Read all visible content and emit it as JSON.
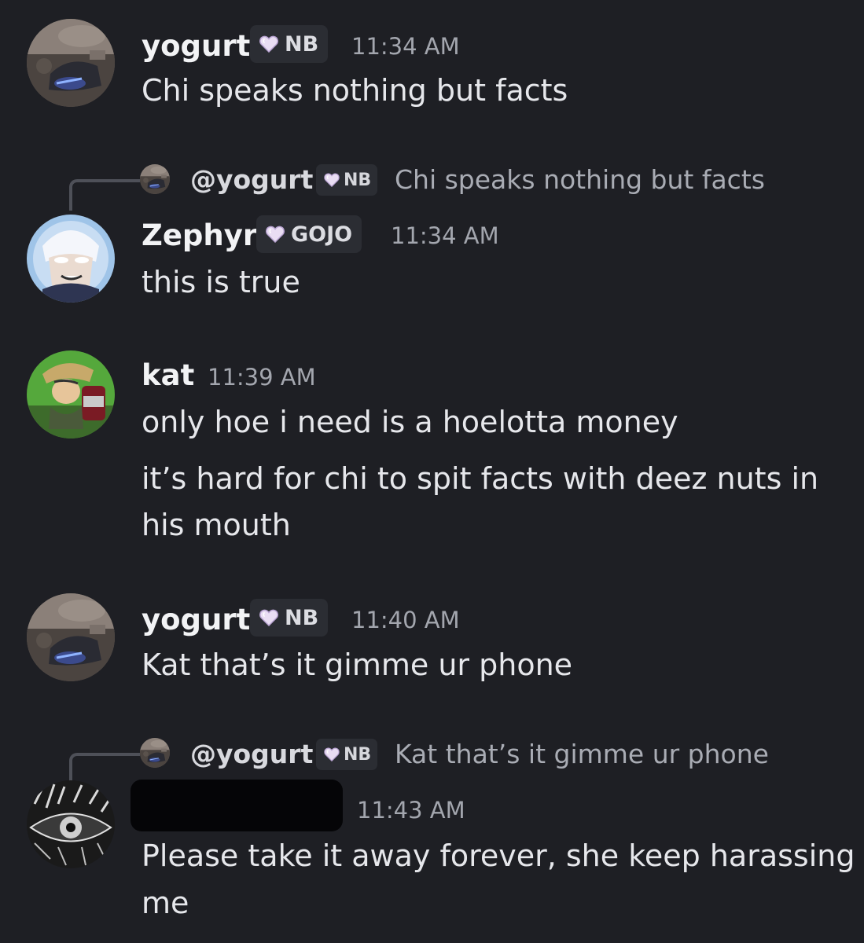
{
  "messages": [
    {
      "username": "yogurt",
      "badge": "NB",
      "timestamp": "11:34 AM",
      "avatar_icon": "yogurt-car-avatar",
      "lines": [
        "Chi speaks nothing but facts"
      ]
    },
    {
      "reply": {
        "mention": "@yogurt",
        "badge": "NB",
        "text": "Chi speaks nothing but facts"
      },
      "username": "Zephyr",
      "badge": "GOJO",
      "timestamp": "11:34 AM",
      "avatar_icon": "gojo-anime-avatar",
      "lines": [
        "this is true"
      ]
    },
    {
      "username": "kat",
      "timestamp": "11:39 AM",
      "avatar_icon": "jojo-dr-pepper-avatar",
      "lines": [
        "only hoe i need is a hoelotta money"
      ],
      "followup_lines": [
        "it’s hard for chi to spit facts with deez nuts in",
        "his mouth"
      ]
    },
    {
      "username": "yogurt",
      "badge": "NB",
      "timestamp": "11:40 AM",
      "avatar_icon": "yogurt-car-avatar",
      "lines": [
        "Kat that’s it gimme ur phone"
      ]
    },
    {
      "reply": {
        "mention": "@yogurt",
        "badge": "NB",
        "text": "Kat that’s it gimme ur phone"
      },
      "username_redacted": true,
      "timestamp": "11:43 AM",
      "avatar_icon": "sketch-eye-avatar",
      "lines": [
        "Please take it away forever, she keep harassing",
        "me"
      ]
    }
  ],
  "colors": {
    "background": "#1e1f24",
    "text": "#e6e7eb",
    "muted": "#a3a6ae",
    "badge_bg": "#2b2d33",
    "heart": "#e3d6f0"
  }
}
